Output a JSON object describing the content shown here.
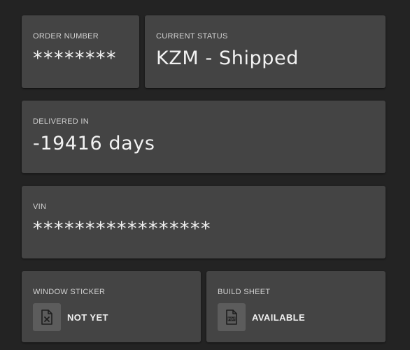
{
  "order": {
    "label": "ORDER NUMBER",
    "value": "********"
  },
  "status": {
    "label": "CURRENT STATUS",
    "value": "KZM - Shipped"
  },
  "delivery": {
    "label": "DELIVERED IN",
    "value": "-19416 days"
  },
  "vin": {
    "label": "VIN",
    "value": "*****************"
  },
  "window_sticker": {
    "label": "WINDOW STICKER",
    "status": "NOT YET",
    "icon": "file-x-icon"
  },
  "build_sheet": {
    "label": "BUILD SHEET",
    "status": "AVAILABLE",
    "icon": "pdf-file-icon"
  },
  "colors": {
    "background": "#232323",
    "card": "#444444",
    "icon_box": "#5c5c5c",
    "text": "#f2f2f2",
    "label_text": "#d2d2d2"
  }
}
